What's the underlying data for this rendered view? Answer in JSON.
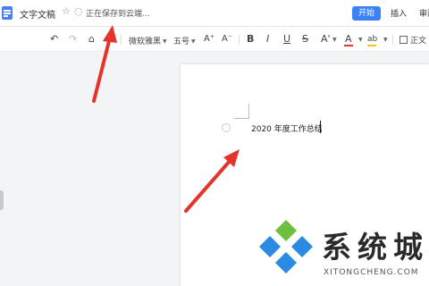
{
  "header": {
    "doc_title": "文字文稿",
    "star_icon": "☆",
    "sync_icon": "◌",
    "saving_status": "正在保存到云端...",
    "tabs": {
      "start": "开始",
      "insert": "插入",
      "review": "审阅"
    }
  },
  "toolbar": {
    "undo_icon": "↶",
    "redo_icon": "↷",
    "format_painter_icon": "⌂",
    "font_name": "微软雅黑",
    "font_size": "五号",
    "grow_font": "A⁺",
    "shrink_font": "A⁻",
    "bold": "B",
    "italic": "I",
    "underline": "U",
    "strikethrough": "S",
    "superscript": "A'",
    "font_color": "A",
    "highlight": "ab",
    "style_normal": "正文",
    "colors": {
      "font_color": "#e53935",
      "highlight": "#f5c518"
    }
  },
  "document": {
    "text": "2020 年度工作总结"
  },
  "watermark": {
    "brand_cn": "系统城",
    "brand_en": "XITONGCHENG.COM"
  },
  "colors": {
    "accent": "#3b82f6",
    "arrow": "#e5352b",
    "logo_blue": "#2b8ae2",
    "logo_green": "#6fbf3f"
  }
}
